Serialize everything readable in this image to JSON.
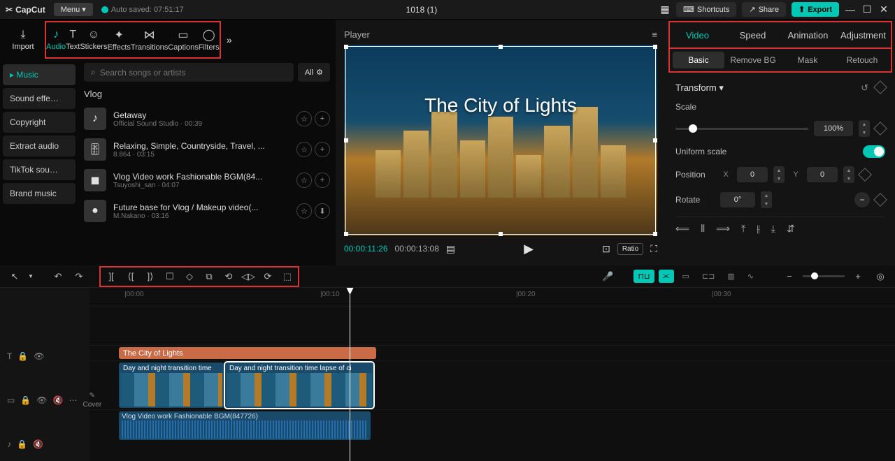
{
  "app": {
    "name": "CapCut",
    "menu_label": "Menu ▾",
    "auto_saved": "Auto saved: 07:51:17",
    "project_title": "1018 (1)"
  },
  "titlebar_buttons": {
    "shortcuts": "Shortcuts",
    "share": "Share",
    "export": "Export"
  },
  "media_tabs": {
    "import": "Import",
    "audio": "Audio",
    "text": "Text",
    "stickers": "Stickers",
    "effects": "Effects",
    "transitions": "Transitions",
    "captions": "Captions",
    "filters": "Filters"
  },
  "side_categories": [
    "Music",
    "Sound effe…",
    "Copyright",
    "Extract audio",
    "TikTok sou…",
    "Brand music"
  ],
  "search": {
    "placeholder": "Search songs or artists",
    "filter_all": "All"
  },
  "section_heading": "Vlog",
  "tracks": [
    {
      "title": "Getaway",
      "meta": "Official Sound Studio · 00:39",
      "thumb": "♪"
    },
    {
      "title": "Relaxing, Simple, Countryside, Travel, ...",
      "meta": "8.864 · 03:15",
      "thumb": "🎚"
    },
    {
      "title": "Vlog Video work Fashionable BGM(84...",
      "meta": "Tsuyoshi_san · 04:07",
      "thumb": "◼"
    },
    {
      "title": "Future base for Vlog / Makeup video(...",
      "meta": "M.Nakano · 03:16",
      "thumb": "●"
    }
  ],
  "player": {
    "label": "Player",
    "overlay_text": "The City of Lights",
    "time_current": "00:00:11:26",
    "time_total": "00:00:13:08",
    "ratio": "Ratio"
  },
  "prop_tabs": [
    "Video",
    "Speed",
    "Animation",
    "Adjustment"
  ],
  "sub_tabs": [
    "Basic",
    "Remove BG",
    "Mask",
    "Retouch"
  ],
  "transform": {
    "heading": "Transform",
    "scale_label": "Scale",
    "scale_value": "100%",
    "uniform_label": "Uniform scale",
    "position_label": "Position",
    "pos_x": "0",
    "pos_y": "0",
    "rotate_label": "Rotate",
    "rotate_value": "0°"
  },
  "ruler_ticks": [
    "|00:00",
    "|00:10",
    "|00:20",
    "|00:30"
  ],
  "clips": {
    "text": {
      "label": "The City of Lights"
    },
    "video1": {
      "label": "Day and night transition time"
    },
    "video2": {
      "label": "Day and night transition time lapse of ci"
    },
    "audio": {
      "label": "Vlog Video work Fashionable BGM(847726)"
    }
  },
  "cover_label": "Cover"
}
